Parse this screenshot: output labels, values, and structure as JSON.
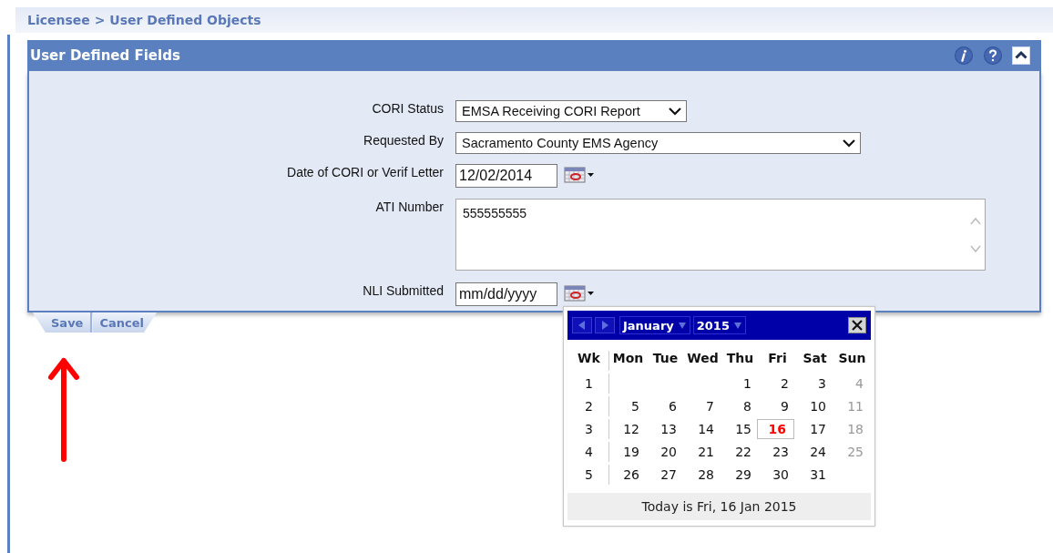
{
  "breadcrumb": "Licensee > User Defined Objects",
  "panel": {
    "title": "User Defined Fields"
  },
  "fields": [
    {
      "label": "CORI Status",
      "kind": "select",
      "value": "EMSA Receiving CORI Report"
    },
    {
      "label": "Requested By",
      "kind": "select_wide",
      "value": "Sacramento County EMS Agency"
    },
    {
      "label": "Date of CORI or Verif Letter",
      "kind": "date",
      "value": "12/02/2014"
    },
    {
      "label": "ATI Number",
      "kind": "textarea",
      "value": "555555555"
    },
    {
      "label": "NLI Submitted",
      "kind": "date",
      "placeholder": "mm/dd/yyyy"
    }
  ],
  "actions": [
    "Save",
    "Cancel"
  ],
  "calendar": {
    "month": "January",
    "year": "2015",
    "headers": [
      "Wk",
      "Mon",
      "Tue",
      "Wed",
      "Thu",
      "Fri",
      "Sat",
      "Sun"
    ],
    "weeks": [
      {
        "week": "1",
        "days": [
          {
            "kind": "blank"
          },
          {
            "kind": "blank"
          },
          {
            "kind": "blank"
          },
          {
            "day": "1",
            "kind": "day"
          },
          {
            "day": "2",
            "kind": "day"
          },
          {
            "day": "3",
            "kind": "day"
          },
          {
            "day": "4",
            "kind": "sunday"
          }
        ]
      },
      {
        "week": "2",
        "days": [
          {
            "day": "5",
            "kind": "day"
          },
          {
            "day": "6",
            "kind": "day"
          },
          {
            "day": "7",
            "kind": "day"
          },
          {
            "day": "8",
            "kind": "day"
          },
          {
            "day": "9",
            "kind": "day"
          },
          {
            "day": "10",
            "kind": "day"
          },
          {
            "day": "11",
            "kind": "sunday"
          }
        ]
      },
      {
        "week": "3",
        "days": [
          {
            "day": "12",
            "kind": "day"
          },
          {
            "day": "13",
            "kind": "day"
          },
          {
            "day": "14",
            "kind": "day"
          },
          {
            "day": "15",
            "kind": "day"
          },
          {
            "day": "16",
            "kind": "today"
          },
          {
            "day": "17",
            "kind": "day"
          },
          {
            "day": "18",
            "kind": "sunday"
          }
        ]
      },
      {
        "week": "4",
        "days": [
          {
            "day": "19",
            "kind": "day"
          },
          {
            "day": "20",
            "kind": "day"
          },
          {
            "day": "21",
            "kind": "day"
          },
          {
            "day": "22",
            "kind": "day"
          },
          {
            "day": "23",
            "kind": "day"
          },
          {
            "day": "24",
            "kind": "day"
          },
          {
            "day": "25",
            "kind": "sunday"
          }
        ]
      },
      {
        "week": "5",
        "days": [
          {
            "day": "26",
            "kind": "day"
          },
          {
            "day": "27",
            "kind": "day"
          },
          {
            "day": "28",
            "kind": "day"
          },
          {
            "day": "29",
            "kind": "day"
          },
          {
            "day": "30",
            "kind": "day"
          },
          {
            "day": "31",
            "kind": "day"
          },
          {
            "kind": "blank"
          }
        ]
      }
    ],
    "footer": "Today is Fri, 16 Jan 2015"
  }
}
